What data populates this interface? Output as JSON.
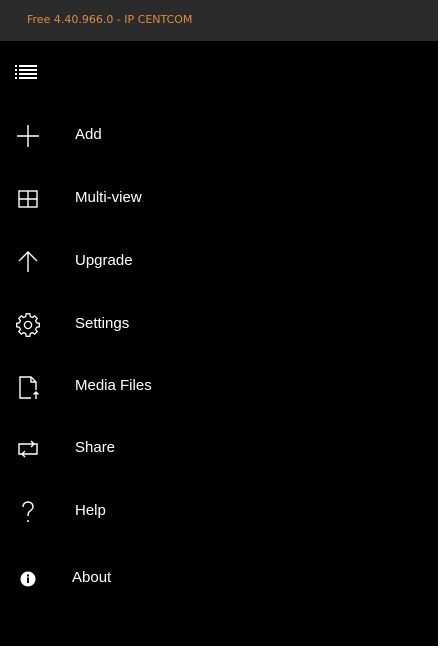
{
  "app": {
    "title": "Free 4.40.966.0 - IP CENTCOM",
    "title_color": "#e08a3c",
    "titlebar_bg": "#2b2b2b",
    "pane_bg": "#000000"
  },
  "nav": {
    "menu_icon": "hamburger-menu-icon",
    "items": [
      {
        "label": "Add",
        "icon": "plus-icon"
      },
      {
        "label": "Multi-view",
        "icon": "grid-icon"
      },
      {
        "label": "Upgrade",
        "icon": "arrow-up-icon"
      },
      {
        "label": "Settings",
        "icon": "gear-icon"
      },
      {
        "label": "Media Files",
        "icon": "document-arrow-icon"
      },
      {
        "label": "Share",
        "icon": "share-icon"
      },
      {
        "label": "Help",
        "icon": "question-icon"
      },
      {
        "label": "About",
        "icon": "info-icon"
      }
    ]
  }
}
